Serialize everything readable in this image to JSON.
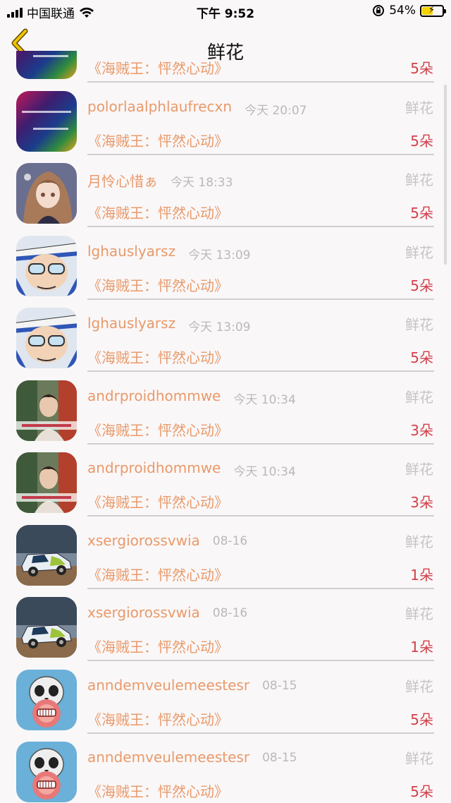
{
  "status": {
    "carrier": "中国联通",
    "time": "下午 9:52",
    "battery": "54%",
    "battery_level": 0.54
  },
  "nav": {
    "title": "鲜花",
    "back_icon": "chevron-left-icon",
    "accent": "#f2c200"
  },
  "colors": {
    "name": "#e89a6a",
    "count": "#d2404a",
    "muted": "#b9b9b9"
  },
  "rows": [
    {
      "name": "",
      "time": "",
      "type": "",
      "gift": "《海贼王：怦然心动》",
      "count": "5朵",
      "avatar": "rainbow"
    },
    {
      "name": "polorlaalphlaufrecxn",
      "time": "今天 20:07",
      "type": "鲜花",
      "gift": "《海贼王：怦然心动》",
      "count": "5朵",
      "avatar": "rainbow"
    },
    {
      "name": "月怜心惜ぁ",
      "time": "今天 18:33",
      "type": "鲜花",
      "gift": "《海贼王：怦然心动》",
      "count": "5朵",
      "avatar": "anime-girl"
    },
    {
      "name": "lghauslyarsz",
      "time": "今天 13:09",
      "type": "鲜花",
      "gift": "《海贼王：怦然心动》",
      "count": "5朵",
      "avatar": "kid"
    },
    {
      "name": "lghauslyarsz",
      "time": "今天 13:09",
      "type": "鲜花",
      "gift": "《海贼王：怦然心动》",
      "count": "5朵",
      "avatar": "kid"
    },
    {
      "name": "andrproidhommwe",
      "time": "今天 10:34",
      "type": "鲜花",
      "gift": "《海贼王：怦然心动》",
      "count": "3朵",
      "avatar": "photo"
    },
    {
      "name": "andrproidhommwe",
      "time": "今天 10:34",
      "type": "鲜花",
      "gift": "《海贼王：怦然心动》",
      "count": "3朵",
      "avatar": "photo"
    },
    {
      "name": "xsergiorossvwia",
      "time": "08-16",
      "type": "鲜花",
      "gift": "《海贼王：怦然心动》",
      "count": "1朵",
      "avatar": "car"
    },
    {
      "name": "xsergiorossvwia",
      "time": "08-16",
      "type": "鲜花",
      "gift": "《海贼王：怦然心动》",
      "count": "1朵",
      "avatar": "car"
    },
    {
      "name": "anndemveulemeestesr",
      "time": "08-15",
      "type": "鲜花",
      "gift": "《海贼王：怦然心动》",
      "count": "5朵",
      "avatar": "skull"
    },
    {
      "name": "anndemveulemeestesr",
      "time": "08-15",
      "type": "鲜花",
      "gift": "《海贼王：怦然心动》",
      "count": "5朵",
      "avatar": "skull"
    }
  ]
}
